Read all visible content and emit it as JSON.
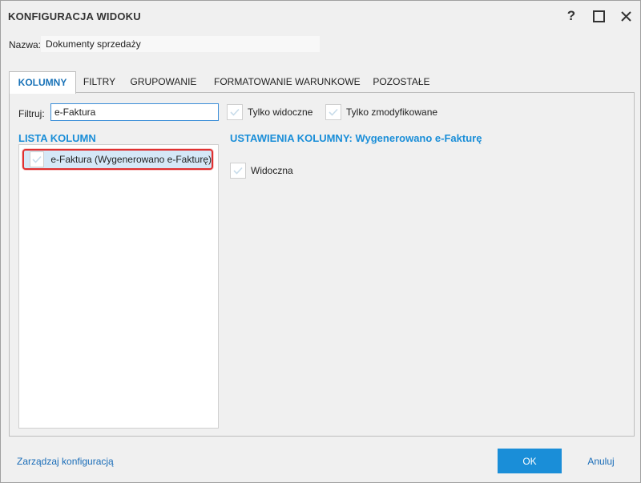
{
  "window": {
    "title": "KONFIGURACJA WIDOKU",
    "help_symbol": "?"
  },
  "name": {
    "label": "Nazwa:",
    "value": "Dokumenty sprzedaży"
  },
  "tabs": [
    {
      "label": "KOLUMNY",
      "active": true
    },
    {
      "label": "FILTRY",
      "active": false
    },
    {
      "label": "GRUPOWANIE",
      "active": false
    },
    {
      "label": "FORMATOWANIE WARUNKOWE",
      "active": false
    },
    {
      "label": "POZOSTAŁE",
      "active": false
    }
  ],
  "filter": {
    "label": "Filtruj:",
    "value": "e-Faktura",
    "only_visible_label": "Tylko widoczne",
    "only_modified_label": "Tylko zmodyfikowane"
  },
  "column_list": {
    "title": "LISTA KOLUMN",
    "items": [
      {
        "label": "e-Faktura (Wygenerowano e-Fakturę)",
        "checked": true,
        "selected": true
      }
    ]
  },
  "column_settings": {
    "title": "USTAWIENIA KOLUMNY: Wygenerowano e-Fakturę",
    "visible_label": "Widoczna"
  },
  "footer": {
    "manage_link": "Zarządzaj konfiguracją",
    "ok_label": "OK",
    "cancel_label": "Anuluj"
  },
  "colors": {
    "accent": "#1a8ed8",
    "highlight_border": "#e03030",
    "selected_row": "#d5e8f7"
  }
}
